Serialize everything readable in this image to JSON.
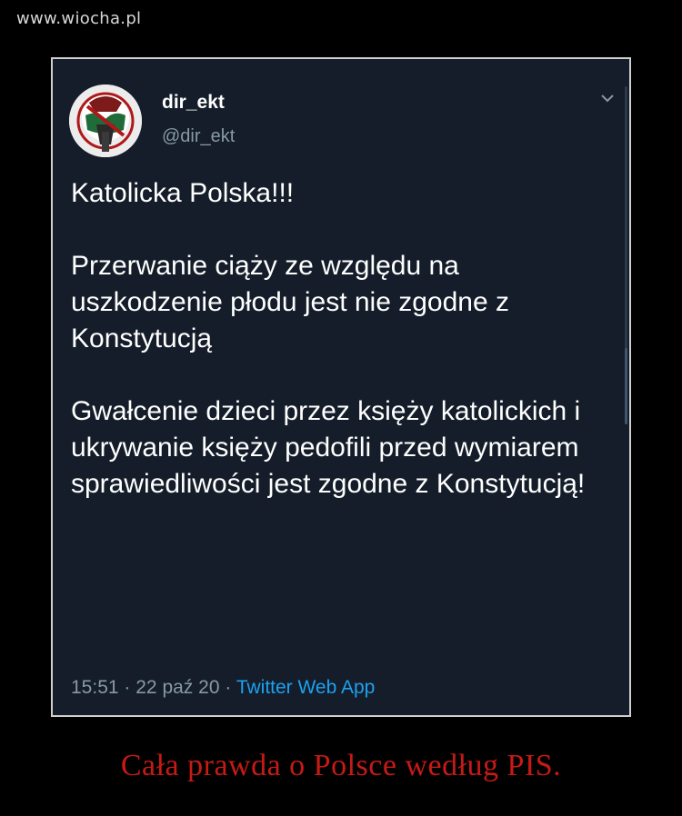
{
  "watermark": "www.wiocha.pl",
  "tweet": {
    "author_name": "dir_ekt",
    "author_handle": "@dir_ekt",
    "avatar_icon": "avatar-image",
    "menu_icon": "chevron-down-icon",
    "text": "Katolicka Polska!!!\n\nPrzerwanie ciąży ze względu na uszkodzenie płodu jest nie zgodne z Konstytucją\n\nGwałcenie dzieci przez księży katolickich i ukrywanie księży pedofili przed wymiarem sprawiedliwości jest zgodne z Konstytucją!",
    "time": "15:51",
    "date": "22 paź 20",
    "separator": "·",
    "source": "Twitter Web App",
    "colors": {
      "background": "#141d29",
      "text": "#ffffff",
      "secondary": "#8899a6",
      "link": "#1da1f2"
    }
  },
  "caption": "Cała prawda o Polsce według PIS.",
  "caption_color": "#c71a15"
}
